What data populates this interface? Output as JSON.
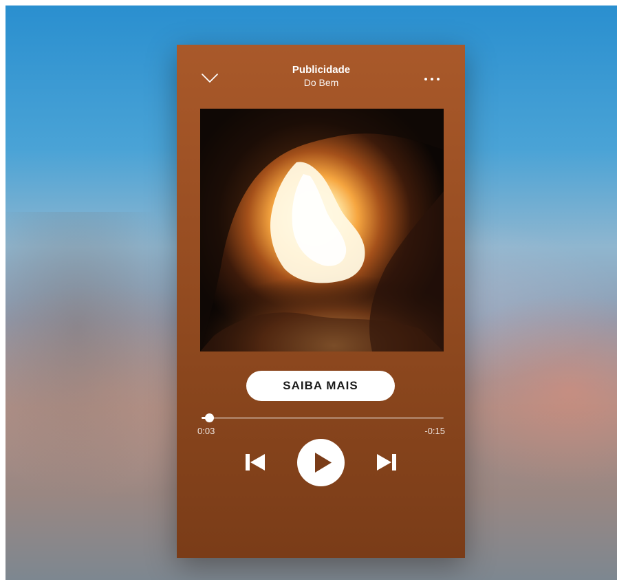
{
  "header": {
    "title": "Publicidade",
    "subtitle": "Do Bem"
  },
  "icons": {
    "collapse": "chevron-down-icon",
    "more": "more-options-icon",
    "previous": "skip-previous-icon",
    "play": "play-icon",
    "next": "skip-next-icon"
  },
  "cta": {
    "label": "SAIBA MAIS"
  },
  "playback": {
    "elapsed": "0:03",
    "remaining": "-0:15",
    "progress": 0.03
  },
  "colors": {
    "player_top": "#a9592a",
    "player_bottom": "#7a3c18",
    "cta_background": "#ffffff",
    "cta_text": "#1a1a1a"
  }
}
